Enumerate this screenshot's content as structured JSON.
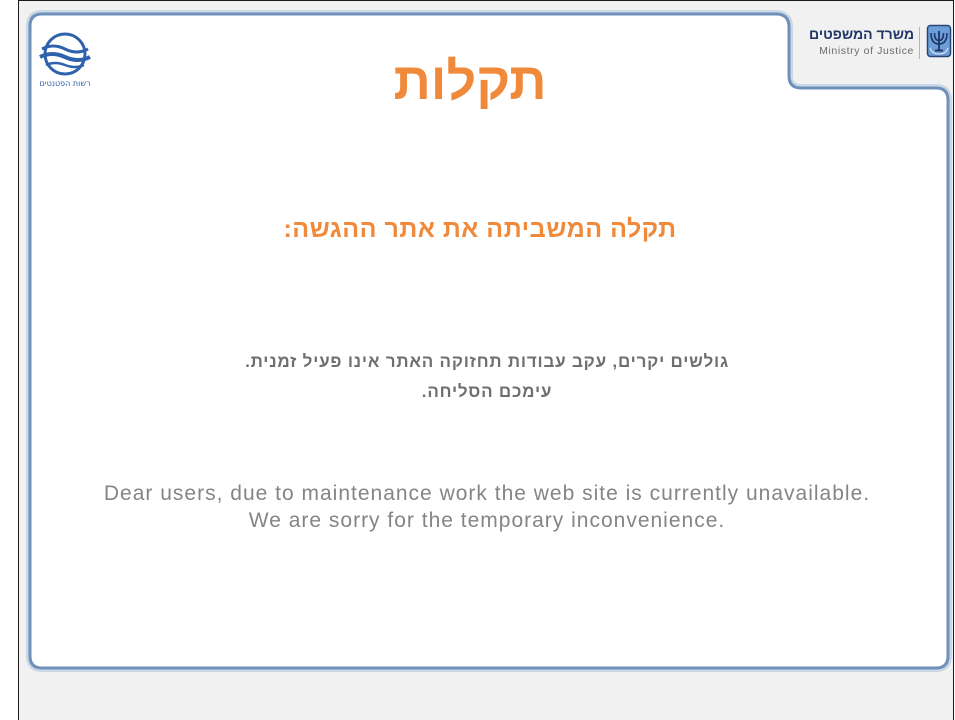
{
  "header": {
    "authority_logo_icon": "authority-logo-icon",
    "authority_name": "רשות הפטנטים",
    "ministry_emblem_icon": "menorah-emblem-icon",
    "ministry_name_he": "משרד המשפטים",
    "ministry_name_en": "Ministry of Justice"
  },
  "main": {
    "title": "תקלות",
    "subtitle": "תקלה המשביתה את אתר ההגשה:",
    "message_he": [
      "גולשים יקרים, עקב עבודות תחזוקה האתר אינו פעיל זמנית.",
      "עימכם הסליחה."
    ],
    "message_en": [
      "Dear users, due to maintenance work the web site is currently unavailable.",
      "We are sorry for the temporary inconvenience."
    ]
  },
  "colors": {
    "accent": "#f08a3a",
    "msg-gray": "#6f6f6f",
    "en-gray": "#858585",
    "panel-border": "#6f90b8",
    "navy": "#1e3566",
    "page-bg": "#f1f1f1"
  }
}
